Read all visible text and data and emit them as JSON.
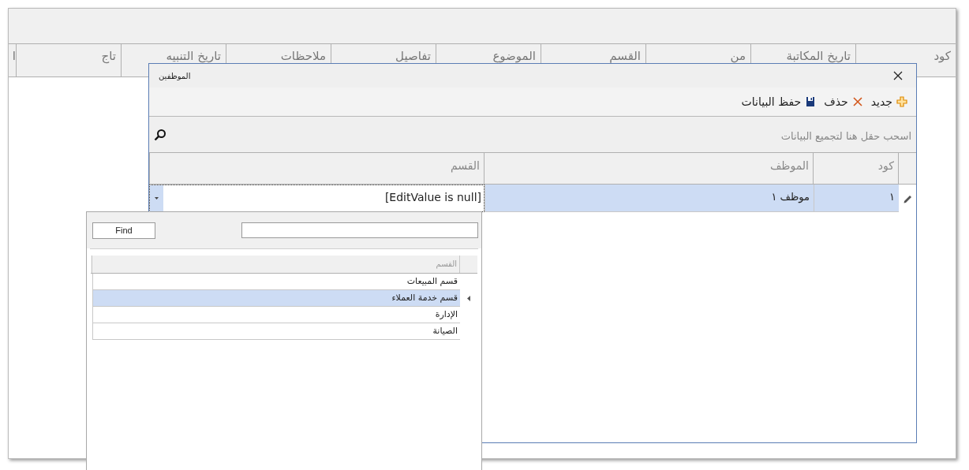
{
  "main_grid": {
    "columns": [
      "كود",
      "تاريخ المكاتبة",
      "من",
      "القسم",
      "الموضوع",
      "تفاصيل",
      "ملاحظات",
      "تاريخ التنبيه",
      "تاج",
      "ا"
    ]
  },
  "dialog": {
    "title": "الموظفين",
    "toolbar": [
      {
        "kind": "new",
        "label": "جديد"
      },
      {
        "kind": "delete",
        "label": "حذف"
      },
      {
        "kind": "save",
        "label": "حفظ البيانات"
      }
    ],
    "group_panel": {
      "text": "اسحب حقل هنا لتجميع البيانات"
    },
    "grid": {
      "columns": [
        "كود",
        "الموظف",
        "القسم"
      ],
      "rows": [
        {
          "selected": true,
          "editing": true,
          "code": "١",
          "employee": "موظف ١",
          "department": "[EditValue is null]"
        }
      ]
    }
  },
  "lookup_popup": {
    "find_button": "Find",
    "column": "القسم",
    "rows": [
      {
        "label": "قسم المبيعات",
        "selected": false
      },
      {
        "label": "قسم خدمة العملاء",
        "selected": true
      },
      {
        "label": "الإدارة",
        "selected": false
      },
      {
        "label": "الصيانة",
        "selected": false
      }
    ]
  }
}
